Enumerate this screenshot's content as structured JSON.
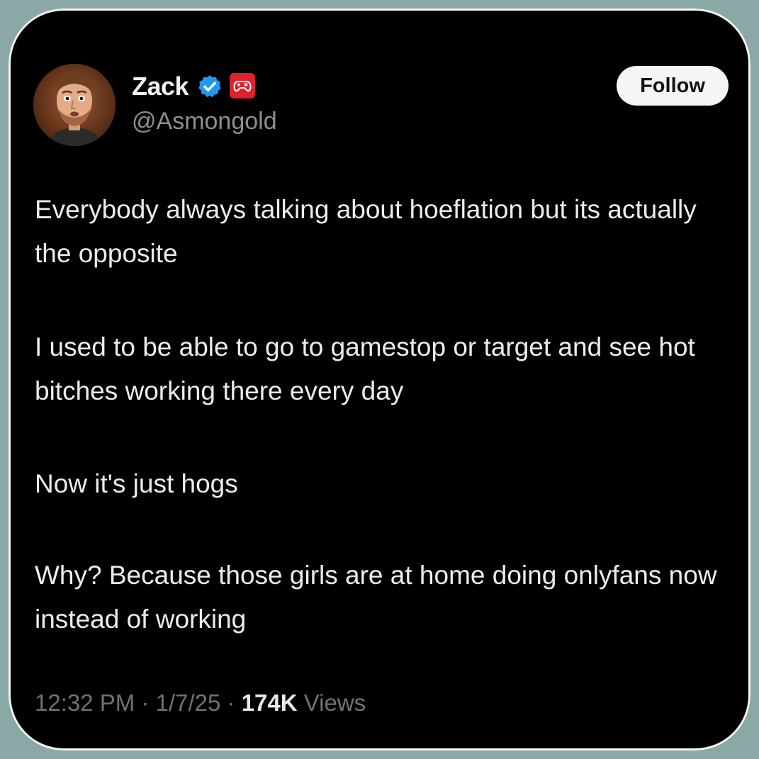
{
  "tweet": {
    "author": {
      "name": "Zack",
      "handle": "@Asmongold"
    },
    "follow_label": "Follow",
    "paragraphs": [
      "Everybody always talking about hoeflation but its actually the opposite",
      "I used to be able to go to gamestop or target and see hot bitches working there every day",
      "Now it's just hogs",
      "Why? Because those girls are at home doing onlyfans now instead of working"
    ],
    "time": "12:32 PM",
    "separator": "·",
    "date": "1/7/25",
    "views_count": "174K",
    "views_label": "Views"
  },
  "icons": {
    "verified": "verified-badge-icon",
    "affiliation": "game-controller-badge-icon"
  },
  "colors": {
    "background": "#8aa8a6",
    "card": "#000000",
    "verified_blue": "#1d9bf0",
    "badge_red": "#e0202a",
    "follow_bg": "#f5f5f5"
  }
}
